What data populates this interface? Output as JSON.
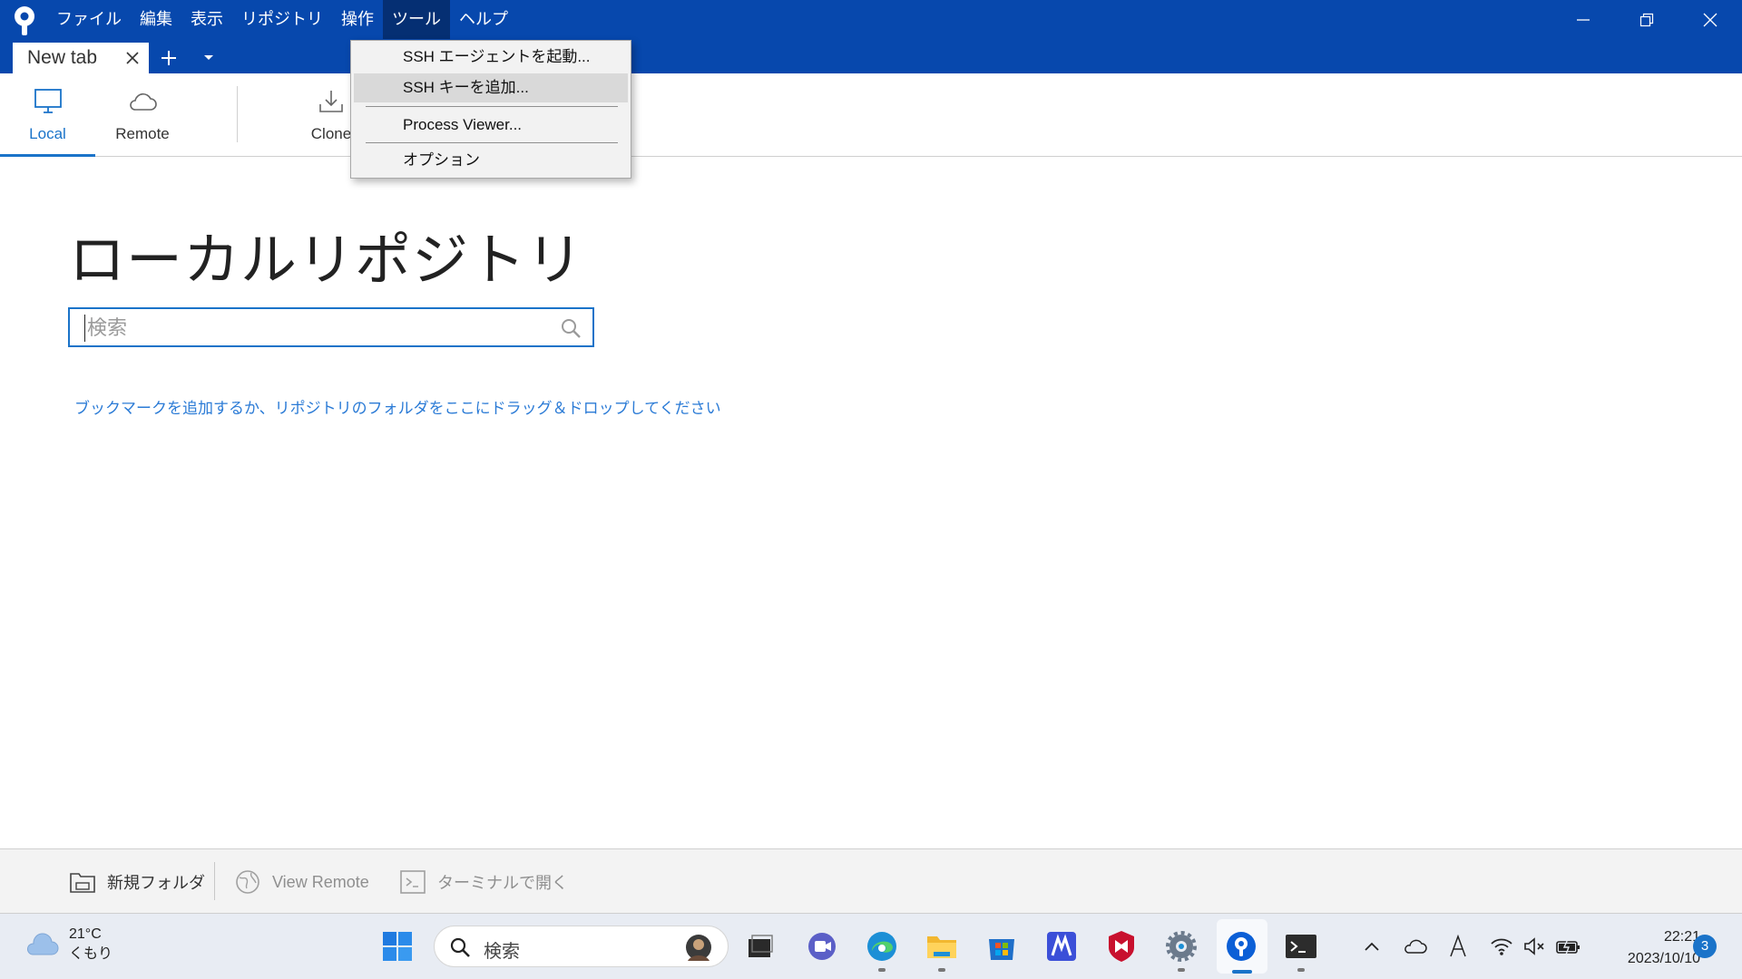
{
  "menubar": {
    "items": [
      {
        "label": "ファイル"
      },
      {
        "label": "編集"
      },
      {
        "label": "表示"
      },
      {
        "label": "リポジトリ"
      },
      {
        "label": "操作"
      },
      {
        "label": "ツール"
      },
      {
        "label": "ヘルプ"
      }
    ]
  },
  "tab": {
    "title": "New tab"
  },
  "toolbar": {
    "local_label": "Local",
    "remote_label": "Remote",
    "clone_label": "Clone"
  },
  "tools_menu": {
    "items": [
      {
        "label": "SSH エージェントを起動..."
      },
      {
        "label": "SSH キーを追加..."
      },
      {
        "label": "Process Viewer..."
      },
      {
        "label": "オプション"
      }
    ]
  },
  "main": {
    "title": "ローカルリポジトリ",
    "search_placeholder": "検索",
    "hint": "ブックマークを追加するか、リポジトリのフォルダをここにドラッグ＆ドロップしてください"
  },
  "bottombar": {
    "new_folder": "新規フォルダ",
    "view_remote": "View Remote",
    "open_terminal": "ターミナルで開く"
  },
  "taskbar": {
    "temperature": "21°C",
    "weather": "くもり",
    "search_label": "検索",
    "time": "22:21",
    "date": "2023/10/10",
    "notifications": "3"
  },
  "colors": {
    "titlebar": "#0748ad",
    "accent": "#1a73c9",
    "hint_link": "#2b7bd6"
  }
}
